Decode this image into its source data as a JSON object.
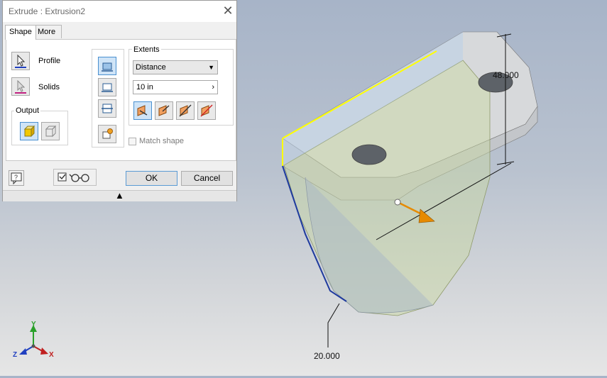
{
  "dialog": {
    "title": "Extrude : Extrusion2",
    "tabs": [
      {
        "label": "Shape",
        "active": true
      },
      {
        "label": "More",
        "active": false
      }
    ],
    "profile_label": "Profile",
    "solids_label": "Solids",
    "output_label": "Output",
    "extents_label": "Extents",
    "extents_type": "Distance",
    "distance_value": "10 in",
    "match_shape_label": "Match shape",
    "ok_label": "OK",
    "cancel_label": "Cancel"
  },
  "viewport": {
    "dimension_top": "48.000",
    "dimension_bottom": "20.000",
    "axes": {
      "x": "X",
      "y": "Y",
      "z": "Z"
    }
  },
  "colors": {
    "accent": "#4a90d0",
    "highlight_edge": "#ffff00",
    "selected_edge": "#1e3a9e",
    "arrow": "#e68a00"
  }
}
